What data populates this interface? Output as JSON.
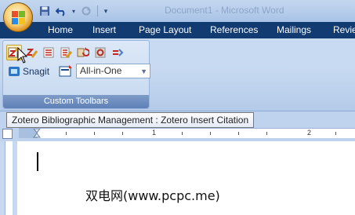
{
  "title_bar": {
    "doc_title": "Document1 - Microsoft Word"
  },
  "quick_access": {
    "buttons": [
      "save-icon",
      "undo-icon",
      "redo-icon",
      "customize-icon"
    ]
  },
  "ribbon": {
    "tabs": [
      {
        "label": "Home"
      },
      {
        "label": "Insert"
      },
      {
        "label": "Page Layout"
      },
      {
        "label": "References"
      },
      {
        "label": "Mailings"
      },
      {
        "label": "Revie"
      }
    ],
    "group": {
      "label": "Custom Toolbars",
      "zotero_buttons": [
        "zotero-insert-citation-icon",
        "zotero-edit-citation-icon",
        "zotero-insert-bibliography-icon",
        "zotero-edit-bibliography-icon",
        "zotero-refresh-icon",
        "zotero-preferences-icon",
        "zotero-unlink-icon"
      ],
      "snagit_label": "Snagit",
      "profile_value": "All-in-One"
    }
  },
  "tooltip": {
    "text": "Zotero Bibliographic Management : Zotero Insert Citation"
  },
  "ruler": {
    "numbers": [
      "1",
      "2"
    ]
  },
  "document": {
    "watermark": "双电网(www.pcpc.me)"
  },
  "colors": {
    "tab_bar": "#123b72",
    "ribbon": "#c7daf1",
    "group_label": "#6a8abd",
    "tooltip_border": "#767676"
  }
}
